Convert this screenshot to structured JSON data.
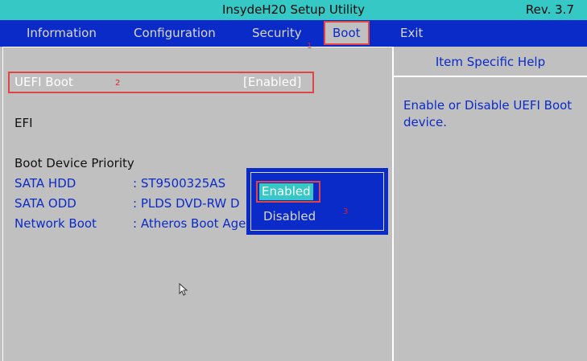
{
  "titlebar": {
    "title": "InsydeH20 Setup Utility",
    "rev": "Rev. 3.7"
  },
  "menu": {
    "information": "Information",
    "configuration": "Configuration",
    "security": "Security",
    "boot": "Boot",
    "exit": "Exit"
  },
  "boot_page": {
    "uefi_boot": {
      "label": "UEFI Boot",
      "value": "[Enabled]"
    },
    "efi_label": "EFI",
    "priority_heading": "Boot Device Priority",
    "devices": [
      {
        "type": "SATA HDD",
        "name": ": ST9500325AS"
      },
      {
        "type": "SATA ODD",
        "name": ": PLDS DVD-RW D"
      },
      {
        "type": "Network Boot",
        "name": ": Atheros Boot Age"
      }
    ]
  },
  "help": {
    "header": "Item Specific Help",
    "text": "Enable or Disable UEFI Boot device."
  },
  "popup": {
    "options": [
      "Enabled",
      "Disabled"
    ],
    "selected": "Enabled"
  },
  "annotations": {
    "a1": "1",
    "a2": "2",
    "a3": "3"
  },
  "colors": {
    "accent_blue": "#0b2bc8",
    "teal": "#36c8c4",
    "background": "#c0c0c0",
    "annotation_red": "#e04545"
  }
}
